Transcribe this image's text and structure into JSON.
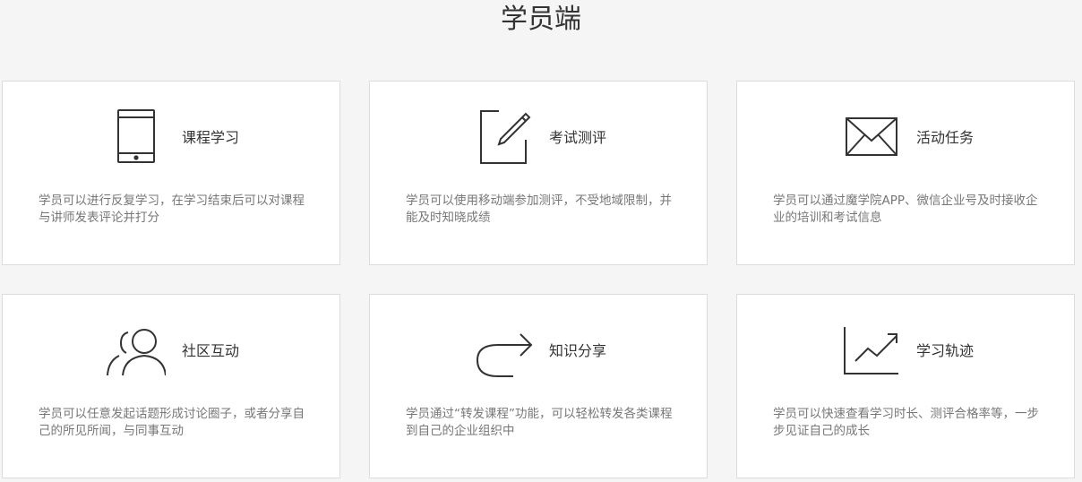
{
  "page": {
    "title": "学员端"
  },
  "cards": [
    {
      "title": "课程学习",
      "desc": "学员可以进行反复学习，在学习结束后可以对课程与讲师发表评论并打分",
      "icon": "tablet-icon"
    },
    {
      "title": "考试测评",
      "desc": "学员可以使用移动端参加测评，不受地域限制，并能及时知晓成绩",
      "icon": "edit-icon"
    },
    {
      "title": "活动任务",
      "desc": "学员可以通过魔学院APP、微信企业号及时接收企业的培训和考试信息",
      "icon": "envelope-icon"
    },
    {
      "title": "社区互动",
      "desc": "学员可以任意发起话题形成讨论圈子，或者分享自己的所见所闻，与同事互动",
      "icon": "users-icon"
    },
    {
      "title": "知识分享",
      "desc": "学员通过“转发课程”功能，可以轻松转发各类课程到自己的企业组织中",
      "icon": "share-arrow-icon"
    },
    {
      "title": "学习轨迹",
      "desc": "学员可以快速查看学习时长、测评合格率等，一步步见证自己的成长",
      "icon": "trend-chart-icon"
    }
  ]
}
